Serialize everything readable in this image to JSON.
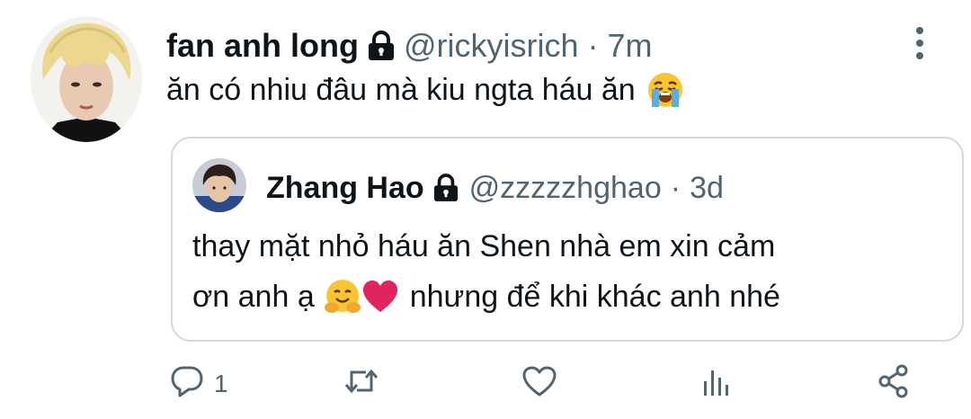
{
  "tweet": {
    "display_name": "fan anh long",
    "handle": "@rickyisrich",
    "separator": "·",
    "time": "7m",
    "text": "ăn có nhiu đâu mà kiu ngta háu ăn",
    "emoji": "loudly-crying-face"
  },
  "quoted": {
    "display_name": "Zhang Hao",
    "handle": "@zzzzzhghao",
    "separator": "·",
    "time": "3d",
    "line1": "thay mặt nhỏ háu ăn Shen nhà em xin cảm",
    "line2_start": "ơn anh ạ",
    "line2_end": "nhưng để khi khác anh nhé",
    "emojis": [
      "hugging-face",
      "red-heart"
    ]
  },
  "actions": {
    "reply_count": "1",
    "icons": [
      "reply-icon",
      "retweet-icon",
      "like-icon",
      "analytics-icon",
      "share-icon"
    ]
  },
  "colors": {
    "text": "#0f1419",
    "secondary": "#536471",
    "border": "#cfd9de",
    "emoji_yellow": "#fbc531",
    "heart_red": "#e0245e"
  }
}
